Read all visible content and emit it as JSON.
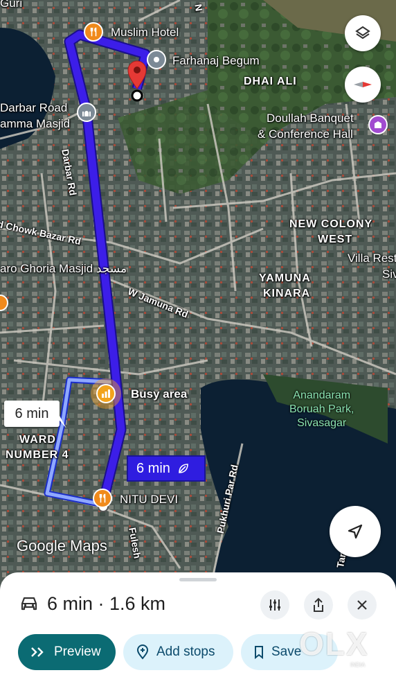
{
  "map": {
    "places": {
      "muslim_hotel": "Muslim Hotel",
      "farhanaj_begum": "Farhanaj Begum",
      "darbar_road_masjid_1": "Darbar Road",
      "darbar_road_masjid_2": "amma Masjid",
      "doullah_1": "Doullah Banquet",
      "doullah_2": "& Conference Hall",
      "ghoria_masjid": "aro Ghoria Masjid مسجد",
      "busy_area": "Busy area",
      "nitu_devi": "NITU DEVI",
      "villa_rest": "Villa Rest",
      "siv_cut": "Siv",
      "top_cut": "Guri"
    },
    "areas": {
      "dhai_ali": "DHAI ALI",
      "new_colony_west_1": "NEW COLONY",
      "new_colony_west_2": "WEST",
      "yamuna_kinara_1": "YAMUNA",
      "yamuna_kinara_2": "KINARA",
      "ward_4_1": "WARD",
      "ward_4_2": "NUMBER 4"
    },
    "roads": {
      "darbar_rd": "Darbar Rd",
      "chowk_bazar_rd": "d Chowk Bazar Rd",
      "w_jamuna_rd": "W Jamuna Rd",
      "pukhuri_par_rd": "Pukhuri Par Rd",
      "fulesh": "Fulesh",
      "tar": "Tar",
      "top_n": "N"
    },
    "park": {
      "line1": "Anandaram",
      "line2": "Boruah Park,",
      "line3": "Sivasagar"
    },
    "route": {
      "primary_time": "6 min",
      "alt_time": "6 min",
      "primary_color": "#3c1ee8",
      "alt_color": "#8fa8ff"
    },
    "logo": "Google Maps"
  },
  "sheet": {
    "summary": "6 min · 1.6 km",
    "preview_label": "Preview",
    "add_stops_label": "Add stops",
    "save_label": "Save",
    "preview_color": "#0b6b73",
    "chip_color": "#dcf2fb"
  },
  "watermark": {
    "text": "OLX",
    "sub": "INDIA"
  }
}
